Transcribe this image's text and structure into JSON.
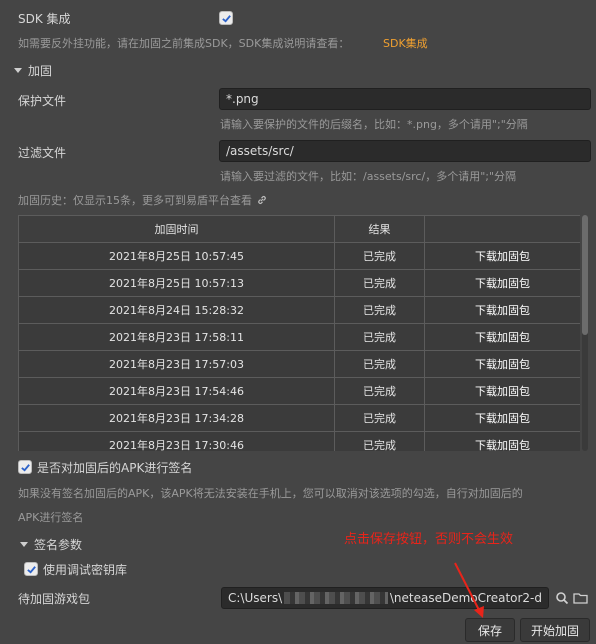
{
  "sdk": {
    "label": "SDK 集成",
    "checked": true,
    "hint": "如需要反外挂功能，请在加固之前集成SDK，SDK集成说明请查看：",
    "link": "SDK集成"
  },
  "reinforce": {
    "section_title": "加固",
    "protect_label": "保护文件",
    "protect_value": "*.png",
    "protect_hint": "请输入要保护的文件的后缀名，比如：*.png，多个请用\";\"分隔",
    "filter_label": "过滤文件",
    "filter_value": "/assets/src/",
    "filter_hint": "请输入要过滤的文件，比如：/assets/src/，多个请用\";\"分隔",
    "history_note": "加固历史：仅显示15条，更多可到易盾平台查看"
  },
  "history_table": {
    "columns": [
      "加固时间",
      "结果",
      ""
    ],
    "rows": [
      {
        "time": "2021年8月25日 10:57:45",
        "result": "已完成",
        "action": "下载加固包"
      },
      {
        "time": "2021年8月25日 10:57:13",
        "result": "已完成",
        "action": "下载加固包"
      },
      {
        "time": "2021年8月24日 15:28:32",
        "result": "已完成",
        "action": "下载加固包"
      },
      {
        "time": "2021年8月23日 17:58:11",
        "result": "已完成",
        "action": "下载加固包"
      },
      {
        "time": "2021年8月23日 17:57:03",
        "result": "已完成",
        "action": "下载加固包"
      },
      {
        "time": "2021年8月23日 17:54:46",
        "result": "已完成",
        "action": "下载加固包"
      },
      {
        "time": "2021年8月23日 17:34:28",
        "result": "已完成",
        "action": "下载加固包"
      },
      {
        "time": "2021年8月23日 17:30:46",
        "result": "已完成",
        "action": "下载加固包"
      }
    ]
  },
  "sign": {
    "sign_apk_label": "是否对加固后的APK进行签名",
    "sign_apk_checked": true,
    "sign_hint_line1": "如果没有签名加固后的APK，该APK将无法安装在手机上，您可以取消对该选项的勾选，自行对加固后的",
    "sign_hint_line2": "APK进行签名",
    "section_title": "签名参数",
    "debug_key_label": "使用调试密钥库",
    "debug_key_checked": true,
    "annotation": "点击保存按钮，否则不会生效",
    "annotation_color": "#e8241a"
  },
  "package": {
    "label": "待加固游戏包",
    "path_prefix": "C:\\Users\\",
    "path_suffix": "\\neteaseDemoCreator2-d"
  },
  "buttons": {
    "save": "保存",
    "start": "开始加固"
  },
  "icons": {
    "link": "link-icon",
    "search": "search-icon",
    "folder": "folder-icon",
    "check": "check-icon",
    "arrow": "annotation-arrow"
  }
}
